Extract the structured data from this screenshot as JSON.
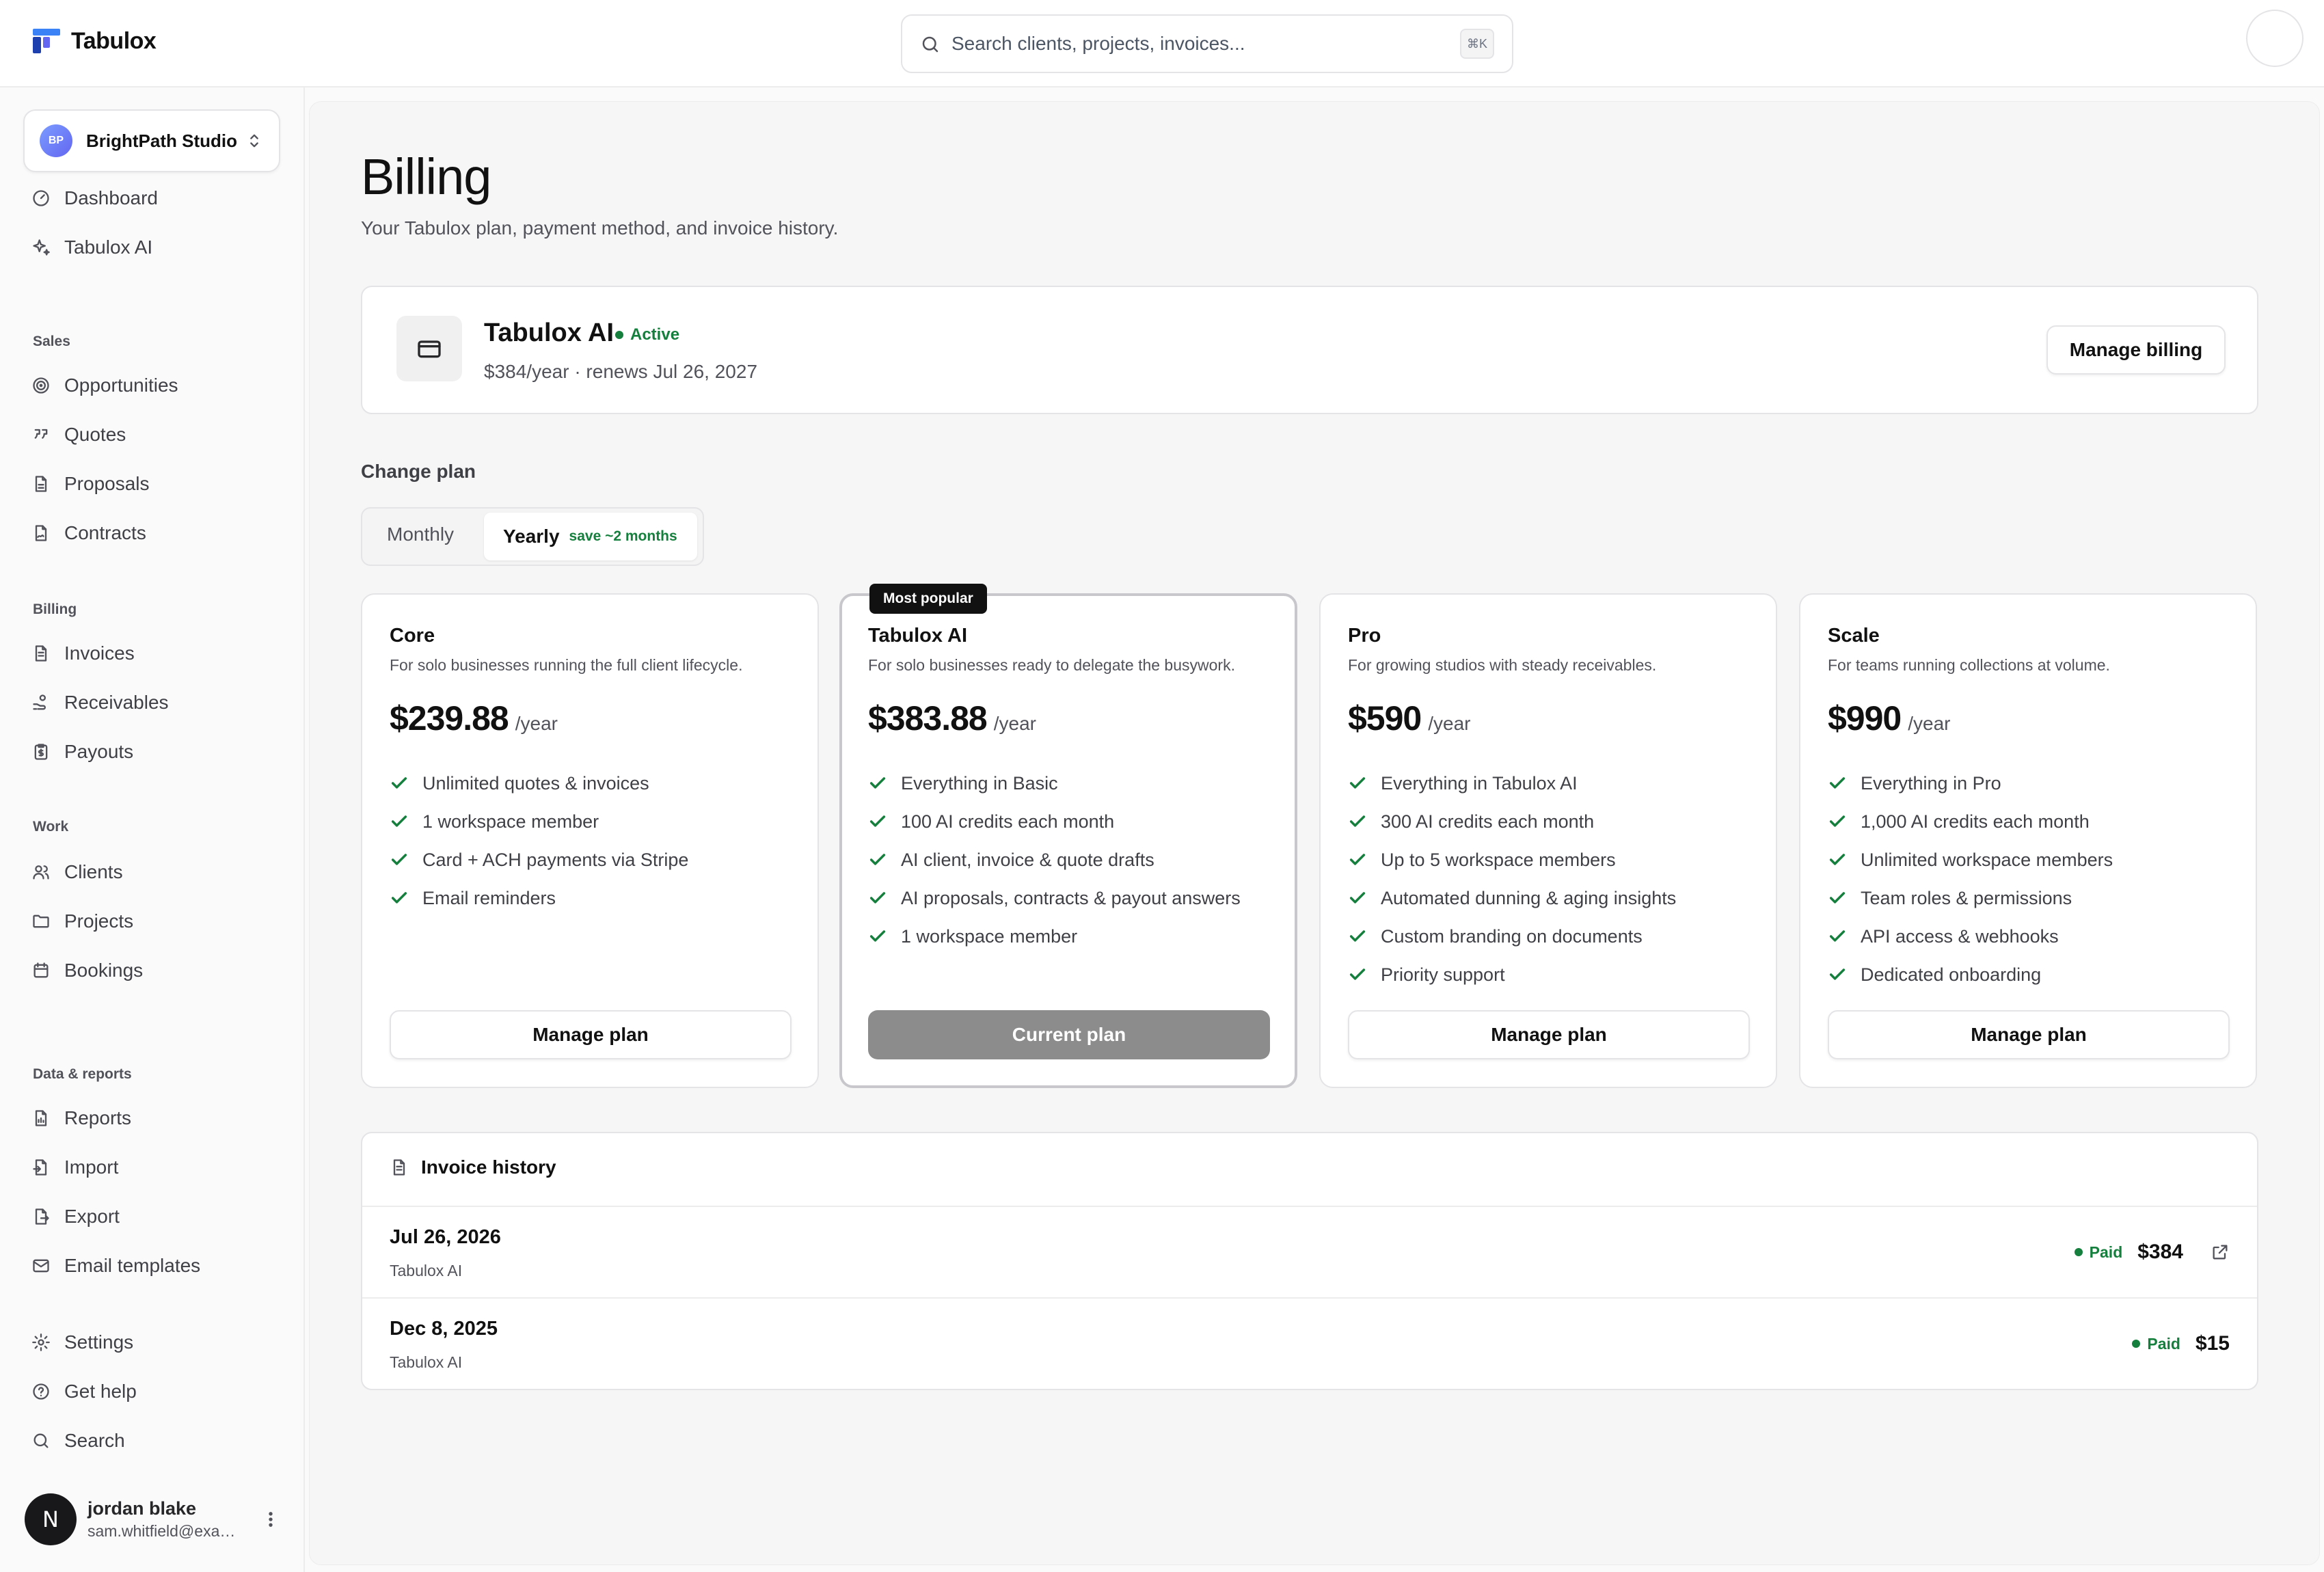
{
  "app": {
    "name": "Tabulox"
  },
  "search": {
    "placeholder": "Search clients, projects, invoices...",
    "shortcut": "⌘K"
  },
  "workspace": {
    "initials": "BP",
    "name": "BrightPath Studio"
  },
  "sidebar": {
    "top": [
      {
        "label": "Dashboard",
        "icon": "gauge-icon"
      },
      {
        "label": "Tabulox AI",
        "icon": "sparkles-icon"
      }
    ],
    "sections": [
      {
        "title": "Sales",
        "items": [
          {
            "label": "Opportunities",
            "icon": "target-icon"
          },
          {
            "label": "Quotes",
            "icon": "quote-icon"
          },
          {
            "label": "Proposals",
            "icon": "file-icon"
          },
          {
            "label": "Contracts",
            "icon": "file-signature-icon"
          }
        ]
      },
      {
        "title": "Billing",
        "items": [
          {
            "label": "Invoices",
            "icon": "file-text-icon"
          },
          {
            "label": "Receivables",
            "icon": "hand-coins-icon"
          },
          {
            "label": "Payouts",
            "icon": "clipboard-dollar-icon"
          }
        ]
      },
      {
        "title": "Work",
        "items": [
          {
            "label": "Clients",
            "icon": "users-icon"
          },
          {
            "label": "Projects",
            "icon": "folder-icon"
          },
          {
            "label": "Bookings",
            "icon": "calendar-icon"
          }
        ]
      },
      {
        "title": "Data & reports",
        "items": [
          {
            "label": "Reports",
            "icon": "file-chart-icon"
          },
          {
            "label": "Import",
            "icon": "import-icon"
          },
          {
            "label": "Export",
            "icon": "export-icon"
          },
          {
            "label": "Email templates",
            "icon": "mail-icon"
          }
        ]
      }
    ],
    "bottom": [
      {
        "label": "Settings",
        "icon": "gear-icon"
      },
      {
        "label": "Get help",
        "icon": "help-circle-icon"
      },
      {
        "label": "Search",
        "icon": "search-icon"
      }
    ]
  },
  "user": {
    "initial": "N",
    "name": "jordan blake",
    "email": "sam.whitfield@example.com"
  },
  "page": {
    "title": "Billing",
    "subtitle": "Your Tabulox plan, payment method, and invoice history."
  },
  "current_plan": {
    "name": "Tabulox AI",
    "status": "Active",
    "meta": "$384/year · renews Jul 26, 2027",
    "button": "Manage billing"
  },
  "change_plan": {
    "label": "Change plan",
    "monthly": "Monthly",
    "yearly": "Yearly",
    "yearly_note": "save ~2 months"
  },
  "tiers": [
    {
      "name": "Core",
      "desc": "For solo businesses running the full client lifecycle.",
      "price": "$239.88",
      "period": "/year",
      "features": [
        "Unlimited quotes & invoices",
        "1 workspace member",
        "Card + ACH payments via Stripe",
        "Email reminders"
      ],
      "button": "Manage plan"
    },
    {
      "name": "Tabulox AI",
      "badge": "Most popular",
      "desc": "For solo businesses ready to delegate the busywork.",
      "price": "$383.88",
      "period": "/year",
      "features": [
        "Everything in Basic",
        "100 AI credits each month",
        "AI client, invoice & quote drafts",
        "AI proposals, contracts & payout answers",
        "1 workspace member"
      ],
      "button": "Current plan"
    },
    {
      "name": "Pro",
      "desc": "For growing studios with steady receivables.",
      "price": "$590",
      "period": "/year",
      "features": [
        "Everything in Tabulox AI",
        "300 AI credits each month",
        "Up to 5 workspace members",
        "Automated dunning & aging insights",
        "Custom branding on documents",
        "Priority support"
      ],
      "button": "Manage plan"
    },
    {
      "name": "Scale",
      "desc": "For teams running collections at volume.",
      "price": "$990",
      "period": "/year",
      "features": [
        "Everything in Pro",
        "1,000 AI credits each month",
        "Unlimited workspace members",
        "Team roles & permissions",
        "API access & webhooks",
        "Dedicated onboarding"
      ],
      "button": "Manage plan"
    }
  ],
  "invoice_history": {
    "title": "Invoice history",
    "rows": [
      {
        "date": "Jul 26, 2026",
        "plan": "Tabulox AI",
        "status": "Paid",
        "amount": "$384"
      },
      {
        "date": "Dec 8, 2025",
        "plan": "Tabulox AI",
        "status": "Paid",
        "amount": "$15"
      }
    ]
  },
  "colors": {
    "accent_green": "#15803d",
    "brand_blue": "#2563eb",
    "dark": "#111111"
  }
}
